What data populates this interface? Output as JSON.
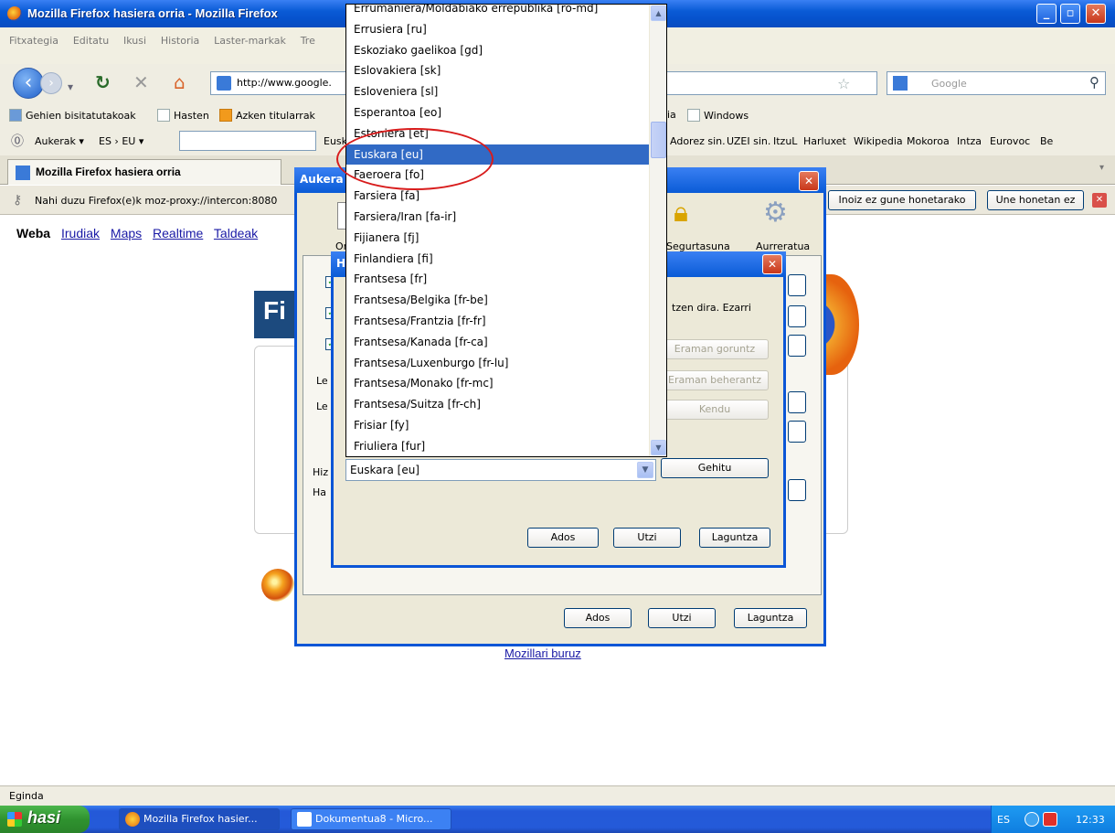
{
  "window": {
    "title": "Mozilla Firefox hasiera orria - Mozilla Firefox",
    "controls": [
      "_",
      "▫",
      "✕"
    ]
  },
  "menu": [
    "Fitxategia",
    "Editatu",
    "Ikusi",
    "Historia",
    "Laster-markak",
    "Tre"
  ],
  "nav": {
    "url": "http://www.google.",
    "search_placeholder": "Google"
  },
  "bookmarks": [
    {
      "label": "Gehien bisitatutakoak",
      "icon": "bookmark-folder-icon"
    },
    {
      "label": "Hasten",
      "icon": "page-icon"
    },
    {
      "label": "Azken titularrak",
      "icon": "rss-icon"
    },
    {
      "label": "ia",
      "icon": ""
    },
    {
      "label": "Windows",
      "icon": "page-icon"
    }
  ],
  "translate_bar": {
    "menu1": "Aukerak ▾",
    "menu2": "ES › EU ▾",
    "lang_tail": "Eusk",
    "links": [
      "Adorez sin.",
      "UZEI sin.",
      "ItzuL",
      "Harluxet",
      "Wikipedia",
      "Mokoroa",
      "Intza",
      "Eurovoc",
      "Be"
    ]
  },
  "tab": {
    "label": "Mozilla Firefox hasiera orria"
  },
  "notification": {
    "message": "Nahi duzu Firefox(e)k moz-proxy://intercon:8080",
    "never_button": "Inoiz ez gune honetarako",
    "not_now_button": "Une honetan ez"
  },
  "page": {
    "links": [
      "Irudiak",
      "Maps",
      "Realtime",
      "Taldeak"
    ],
    "first": "Weba",
    "logo_fragment": "Fi",
    "about": "Mozillari buruz"
  },
  "options_dialog": {
    "title": "Aukera",
    "panes": [
      {
        "label": "Orok",
        "icon": "general-icon"
      },
      {
        "label": "Segurtasuna",
        "icon": "lock-icon"
      },
      {
        "label": "Aurreratua",
        "icon": "gear-icon"
      }
    ],
    "group_labels": [
      "Le",
      "Le",
      "Hiz",
      "Ha"
    ],
    "ok": "Ados",
    "cancel": "Utzi",
    "help": "Laguntza"
  },
  "languages_dialog": {
    "title": "H",
    "description": "tzen dira. Ezarri",
    "move_up": "Eraman goruntz",
    "move_down": "Eraman beherantz",
    "remove": "Kendu",
    "add": "Gehitu",
    "selected_value": "Euskara [eu]",
    "ok": "Ados",
    "cancel": "Utzi",
    "help": "Laguntza"
  },
  "dropdown": {
    "options": [
      "Errumaniera/Moldabiako errepublika [ro-md]",
      "Errusiera [ru]",
      "Eskoziako gaelikoa [gd]",
      "Eslovakiera [sk]",
      "Esloveniera [sl]",
      "Esperantoa [eo]",
      "Estoniera [et]",
      "Euskara [eu]",
      "Faeroera [fo]",
      "Farsiera [fa]",
      "Farsiera/Iran [fa-ir]",
      "Fijianera [fj]",
      "Finlandiera [fi]",
      "Frantsesa [fr]",
      "Frantsesa/Belgika [fr-be]",
      "Frantsesa/Frantzia [fr-fr]",
      "Frantsesa/Kanada [fr-ca]",
      "Frantsesa/Luxenburgo [fr-lu]",
      "Frantsesa/Monako [fr-mc]",
      "Frantsesa/Suitza [fr-ch]",
      "Frisiar [fy]",
      "Friuliera [fur]"
    ],
    "selected_index": 7
  },
  "status": "Eginda",
  "taskbar": {
    "start": "hasi",
    "items": [
      "Mozilla Firefox hasier...",
      "Dokumentua8 - Micro..."
    ],
    "lang": "ES",
    "time": "12:33"
  },
  "colors": {
    "xp_blue": "#0a5bd6",
    "selection": "#316ac5",
    "annotation_red": "#d81c1c"
  }
}
